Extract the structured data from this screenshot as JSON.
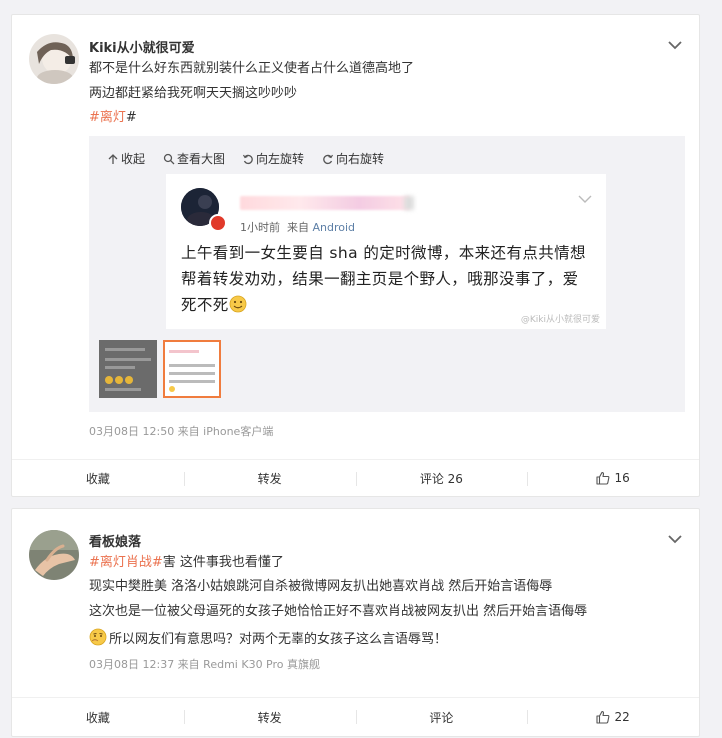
{
  "post1": {
    "username": "Kiki从小就很可爱",
    "text_lines": [
      "都不是什么好东西就别装什么正义使者占什么道德高地了",
      "两边都赶紧给我死啊天天搁这吵吵吵"
    ],
    "hashtag_prefix": "#",
    "hashtag_name": "离灯",
    "hashtag_suffix": "#",
    "media_toolbar": {
      "collapse": "收起",
      "view_large": "查看大图",
      "rotate_left": "向左旋转",
      "rotate_right": "向右旋转"
    },
    "image_post": {
      "time": "1小时前",
      "source_prefix": "来自",
      "source": "Android",
      "body": "上午看到一女生要自 sha 的定时微博，本来还有点共情想帮着转发劝劝，结果一翻主页是个野人，哦那没事了，爱死不死",
      "watermark": "@Kiki从小就很可爱"
    },
    "meta": "03月08日 12:50  来自 iPhone客户端",
    "actions": {
      "favorite": "收藏",
      "repost": "转发",
      "comment": "评论 26",
      "like_count": "16"
    }
  },
  "post2": {
    "username": "看板娘落",
    "hashtag1": "#离灯肖战#",
    "line1_rest": "害 这件事我也看懂了",
    "line2": "现实中樊胜美 洛洛小姑娘跳河自杀被微博网友扒出她喜欢肖战 然后开始言语侮辱",
    "line3": "这次也是一位被父母逼死的女孩子她恰恰正好不喜欢肖战被网友扒出 然后开始言语侮辱",
    "line4": "所以网友们有意思吗？对两个无辜的女孩子这么言语辱骂！",
    "meta": "03月08日 12:37  来自 Redmi K30 Pro 真旗舰",
    "actions": {
      "favorite": "收藏",
      "repost": "转发",
      "comment": "评论",
      "like_count": "22"
    }
  },
  "colors": {
    "accent_orange": "#eb7350",
    "link_blue": "#5d7fa6",
    "thumb_border": "#f07c3e"
  }
}
